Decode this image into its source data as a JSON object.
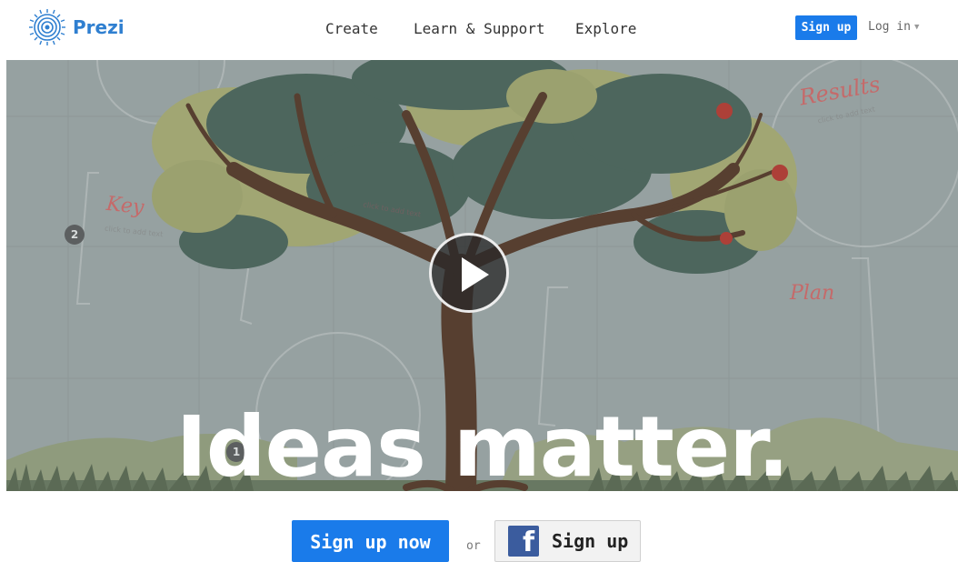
{
  "header": {
    "logo_text": "Prezi",
    "nav": [
      "Create",
      "Learn & Support",
      "Explore"
    ],
    "signup_label": "Sign up",
    "login_label": "Log in"
  },
  "hero": {
    "headline": "Ideas matter.",
    "labels": {
      "key": "Key",
      "results": "Results",
      "plan": "Plan"
    },
    "hints": {
      "key": "click to add text",
      "results": "click to add text",
      "mid": "click to add text"
    },
    "badges": {
      "two": "2",
      "one": "1"
    }
  },
  "cta": {
    "signup_now": "Sign up now",
    "or": "or",
    "fb_signup": "Sign up",
    "fb_glyph": "f"
  },
  "colors": {
    "brand_blue": "#1a7bea",
    "facebook_blue": "#3b5c9e",
    "leaf_dark": "#3d5a4f",
    "leaf_light": "#a4a86a"
  },
  "icons": {
    "logo": "prezi-logo-icon",
    "play": "play-icon",
    "facebook": "facebook-icon",
    "caret": "caret-down-icon"
  }
}
